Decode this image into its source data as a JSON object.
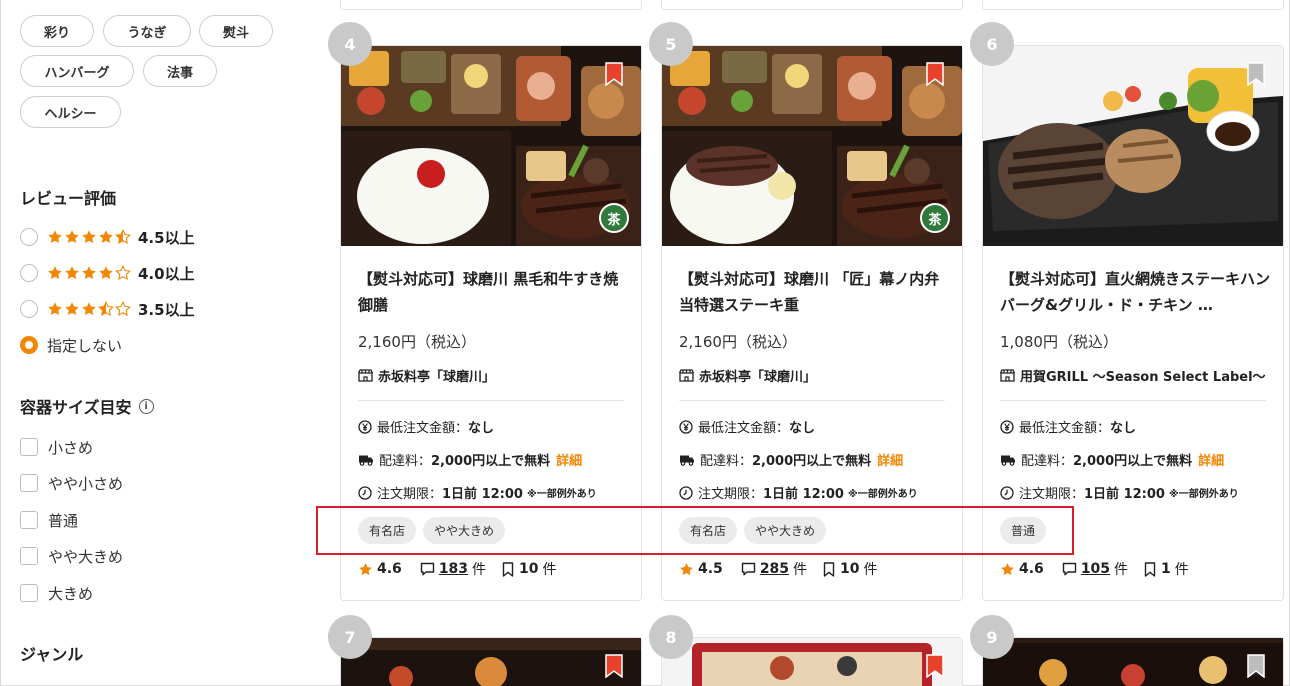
{
  "tags_filter": [
    "彩り",
    "うなぎ",
    "熨斗",
    "ハンバーグ",
    "法事",
    "ヘルシー"
  ],
  "review": {
    "title": "レビュー評価",
    "options": [
      {
        "label": "4.5以上",
        "stars": 4.5,
        "selected": false
      },
      {
        "label": "4.0以上",
        "stars": 4.0,
        "selected": false
      },
      {
        "label": "3.5以上",
        "stars": 3.5,
        "selected": false
      },
      {
        "label": "指定しない",
        "stars": 0,
        "selected": true
      }
    ]
  },
  "container_size": {
    "title": "容器サイズ目安",
    "info_icon": "i",
    "options": [
      "小さめ",
      "やや小さめ",
      "普通",
      "やや大きめ",
      "大きめ"
    ]
  },
  "genre": {
    "title": "ジャンル"
  },
  "colors": {
    "accent": "#f28705",
    "highlight": "#d81e2a",
    "bookmark_red": "#e8412c",
    "bookmark_gray": "#bdbdbd",
    "tea_green": "#2f7a3a"
  },
  "cards": [
    {
      "rank": "4",
      "title": "【熨斗対応可】球磨川 黒毛和牛すき焼御膳",
      "price": "2,160円（税込）",
      "shop": "赤坂料亭「球磨川」",
      "min_order_label": "最低注文金額：",
      "min_order_value": "なし",
      "delivery_label": "配達料：",
      "delivery_value": "2,000円以上で無料",
      "detail_link": "詳細",
      "deadline_label": "注文期限：",
      "deadline_value": "1日前 12:00",
      "deadline_note": "※一部例外あり",
      "tags": [
        "有名店",
        "やや大きめ"
      ],
      "rating": "4.6",
      "reviews": "183",
      "reviews_unit": "件",
      "bookmarks": "10",
      "bookmarks_unit": "件",
      "bookmarked": true,
      "tea_badge": "茶"
    },
    {
      "rank": "5",
      "title": "【熨斗対応可】球磨川 「匠」幕ノ内弁当特選ステーキ重",
      "price": "2,160円（税込）",
      "shop": "赤坂料亭「球磨川」",
      "min_order_label": "最低注文金額：",
      "min_order_value": "なし",
      "delivery_label": "配達料：",
      "delivery_value": "2,000円以上で無料",
      "detail_link": "詳細",
      "deadline_label": "注文期限：",
      "deadline_value": "1日前 12:00",
      "deadline_note": "※一部例外あり",
      "tags": [
        "有名店",
        "やや大きめ"
      ],
      "rating": "4.5",
      "reviews": "285",
      "reviews_unit": "件",
      "bookmarks": "10",
      "bookmarks_unit": "件",
      "bookmarked": true,
      "tea_badge": "茶"
    },
    {
      "rank": "6",
      "title": "【熨斗対応可】直火網焼きステーキハンバーグ&グリル・ド・チキン …",
      "price": "1,080円（税込）",
      "shop": "用賀GRILL ～Season Select Label～",
      "min_order_label": "最低注文金額：",
      "min_order_value": "なし",
      "delivery_label": "配達料：",
      "delivery_value": "2,000円以上で無料",
      "detail_link": "詳細",
      "deadline_label": "注文期限：",
      "deadline_value": "1日前 12:00",
      "deadline_note": "※一部例外あり",
      "tags": [
        "普通"
      ],
      "rating": "4.6",
      "reviews": "105",
      "reviews_unit": "件",
      "bookmarks": "1",
      "bookmarks_unit": "件",
      "bookmarked": false,
      "tea_badge": ""
    }
  ],
  "next_ranks": [
    "7",
    "8",
    "9"
  ]
}
